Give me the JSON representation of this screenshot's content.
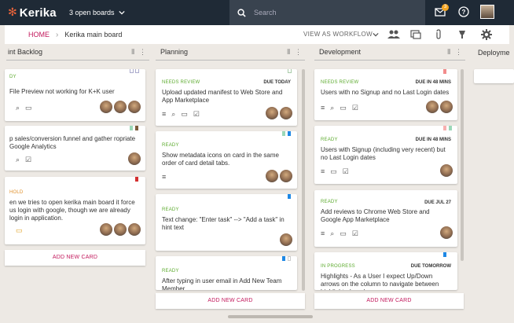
{
  "topbar": {
    "logo": "Kerika",
    "boards_label": "3 open boards",
    "search_placeholder": "Search",
    "notification_count": "3",
    "bg_color": "#1f2a36",
    "accent": "#c2185b"
  },
  "navbar": {
    "home": "HOME",
    "board_name": "Kerika main board",
    "view_label": "VIEW AS WORKFLOW"
  },
  "columns": [
    {
      "name": "int Backlog",
      "add_label": "ADD NEW CARD",
      "cards": [
        {
          "status": "DY",
          "due": "",
          "title": "File Preview not working for K+K user"
        },
        {
          "status": "",
          "due": "",
          "title": "p sales/conversion funnel and gather ropriate Google Analytics"
        },
        {
          "status": "HOLD",
          "due": "",
          "title": "en we tries to open kerika main board it force us login with google, though we are already login in application."
        }
      ]
    },
    {
      "name": "Planning",
      "add_label": "ADD NEW CARD",
      "cards": [
        {
          "status": "NEEDS REVIEW",
          "due": "DUE TODAY",
          "title": "Upload updated manifest to Web Store and App Marketplace"
        },
        {
          "status": "READY",
          "due": "",
          "title": "Show metadata icons on card in the same order of card detail tabs."
        },
        {
          "status": "READY",
          "due": "",
          "title": "Text change: \"Enter task\" --> \"Add a task\" in hint text"
        },
        {
          "status": "READY",
          "due": "",
          "title": "After typing in user email in Add New Team Member ..."
        }
      ]
    },
    {
      "name": "Development",
      "add_label": "ADD NEW CARD",
      "cards": [
        {
          "status": "NEEDS REVIEW",
          "due": "DUE IN 48 MINS",
          "title": "Users with no Signup and no Last Login dates"
        },
        {
          "status": "READY",
          "due": "DUE IN 48 MINS",
          "title": "Users with Signup (including very recent) but no Last Login dates"
        },
        {
          "status": "READY",
          "due": "DUE JUL 27",
          "title": "Add reviews to Chrome Web Store and Google App Marketplace"
        },
        {
          "status": "IN PROGRESS",
          "due": "DUE TOMORROW",
          "title": "Highlights - As a User I expect Up/Down arrows on the column to navigate between highlighted cards"
        }
      ]
    },
    {
      "name": "Deployme",
      "add_label": "",
      "cards": []
    }
  ]
}
